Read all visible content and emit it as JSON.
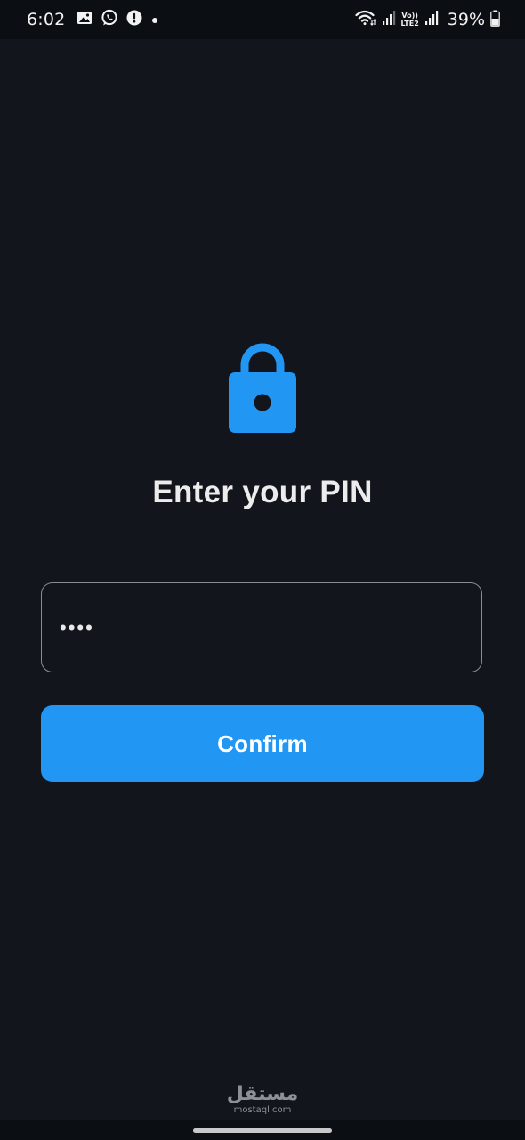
{
  "status_bar": {
    "time": "6:02",
    "battery_percent": "39%",
    "lte_top": "Vo))",
    "lte_bottom": "LTE2",
    "icons": [
      "gallery-icon",
      "whatsapp-icon",
      "alert-icon",
      "notification-dot-icon",
      "wifi-icon",
      "signal-icon",
      "battery-icon"
    ]
  },
  "lock_screen": {
    "title": "Enter your PIN",
    "pin_value": "••••",
    "confirm_label": "Confirm",
    "lock_icon": "lock-icon"
  },
  "watermark": {
    "arabic": "مستقل",
    "latin": "mostaql.com"
  },
  "colors": {
    "background": "#12151c",
    "accent": "#2196f3",
    "title_text": "#ececec",
    "field_border": "#8a8d92"
  }
}
